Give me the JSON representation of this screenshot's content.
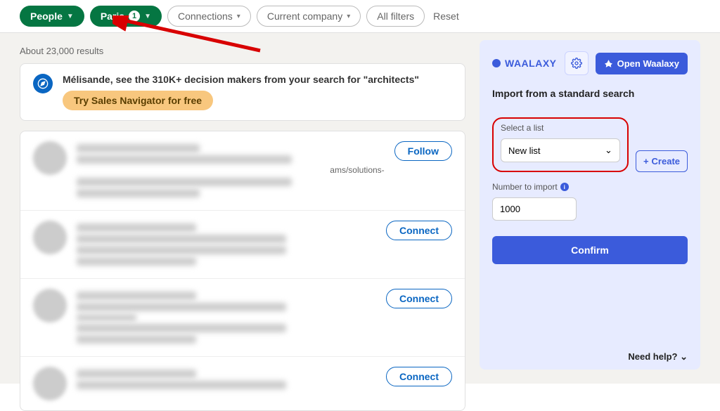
{
  "filters": {
    "people": "People",
    "location": "Paris",
    "location_count": "1",
    "connections": "Connections",
    "company": "Current company",
    "all": "All filters",
    "reset": "Reset"
  },
  "results_count": "About 23,000 results",
  "promo": {
    "headline": "Mélisande, see the 310K+ decision makers from your search for \"architects\"",
    "cta": "Try Sales Navigator for free"
  },
  "results": [
    {
      "action": "Follow",
      "fragment": "ams/solutions-"
    },
    {
      "action": "Connect"
    },
    {
      "action": "Connect"
    },
    {
      "action": "Connect"
    }
  ],
  "panel": {
    "brand": "WAALAXY",
    "open": "Open Waalaxy",
    "title": "Import from a standard search",
    "select_label": "Select a list",
    "select_value": "New list",
    "create": "Create",
    "number_label": "Number to import",
    "number_value": "1000",
    "confirm": "Confirm",
    "help": "Need help?"
  }
}
